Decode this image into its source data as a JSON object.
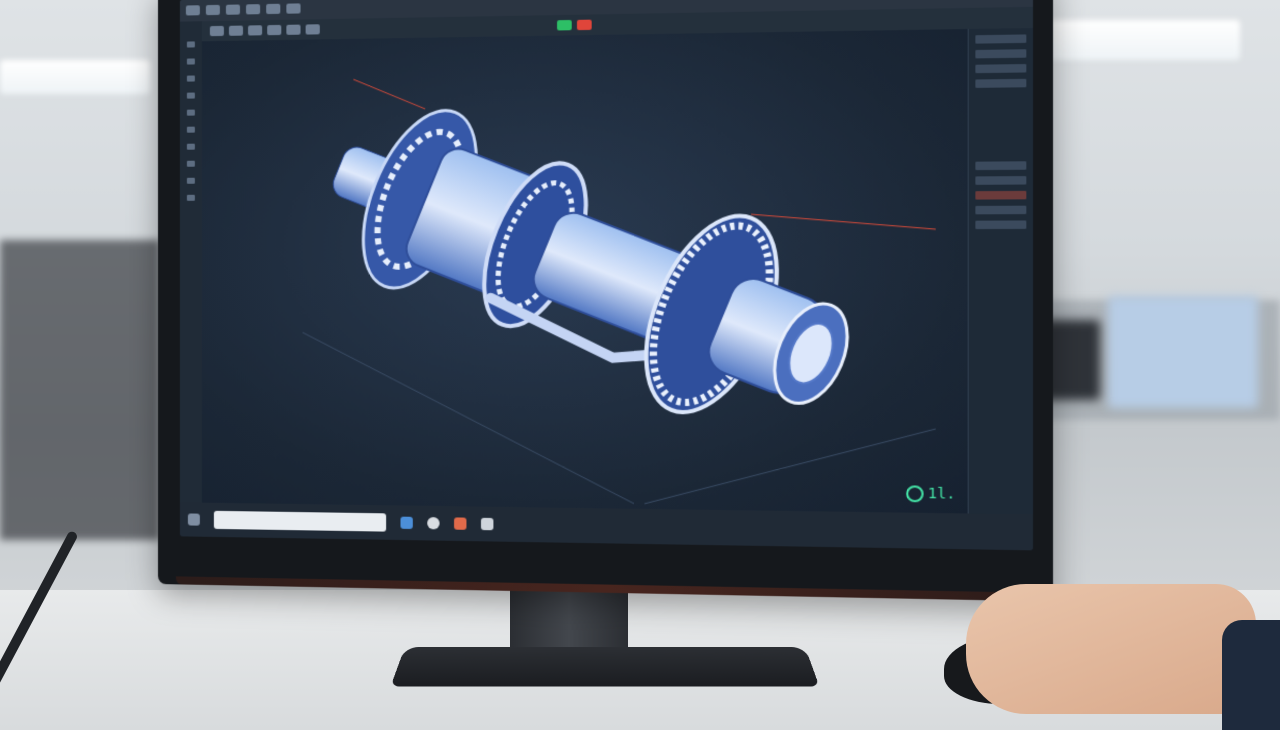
{
  "scene": {
    "description_colors": {
      "screen_bg": "#1c2733",
      "wireframe": "#5b8ad8",
      "accent": "#43e0a4"
    }
  },
  "software": {
    "status_readout": "1l.",
    "icons": [
      "select-icon",
      "move-icon",
      "rotate-icon",
      "scale-icon",
      "measure-icon",
      "layers-icon"
    ]
  }
}
